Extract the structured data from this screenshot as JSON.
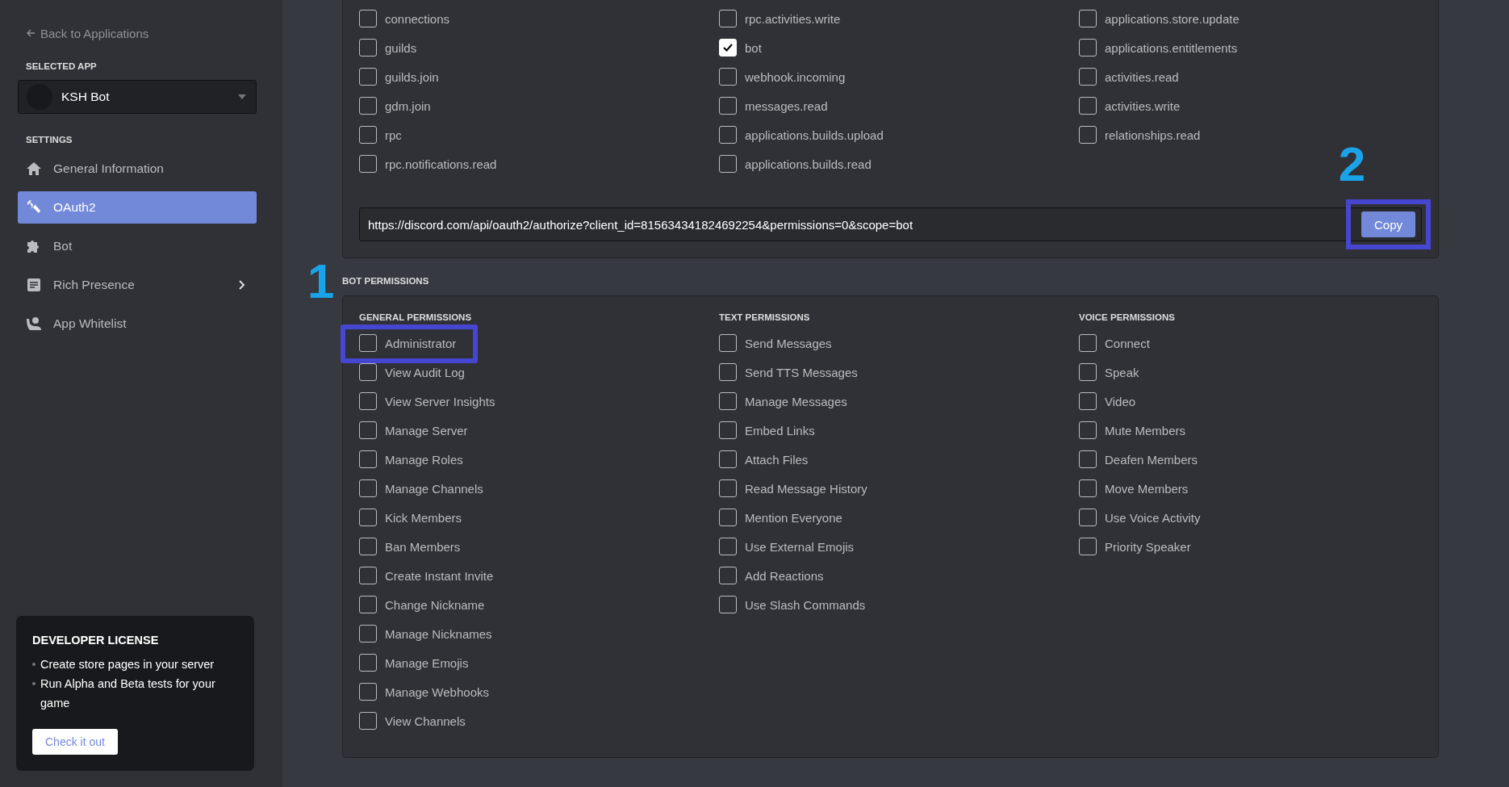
{
  "sidebar": {
    "back_link": "Back to Applications",
    "selected_app_label": "SELECTED APP",
    "selected_app": "KSH Bot",
    "settings_label": "SETTINGS",
    "items": [
      {
        "label": "General Information",
        "kind": "home",
        "selected": false,
        "expandable": false
      },
      {
        "label": "OAuth2",
        "kind": "wrench",
        "selected": true,
        "expandable": false
      },
      {
        "label": "Bot",
        "kind": "puzzle",
        "selected": false,
        "expandable": false
      },
      {
        "label": "Rich Presence",
        "kind": "document",
        "selected": false,
        "expandable": true
      },
      {
        "label": "App Whitelist",
        "kind": "person",
        "selected": false,
        "expandable": false
      }
    ]
  },
  "developer_license": {
    "title": "DEVELOPER LICENSE",
    "bullets": [
      "Create store pages in your server",
      "Run Alpha and Beta tests for your game"
    ],
    "button": "Check it out"
  },
  "scopes": {
    "columns": [
      [
        {
          "label": "connections",
          "checked": false
        },
        {
          "label": "guilds",
          "checked": false
        },
        {
          "label": "guilds.join",
          "checked": false
        },
        {
          "label": "gdm.join",
          "checked": false
        },
        {
          "label": "rpc",
          "checked": false
        },
        {
          "label": "rpc.notifications.read",
          "checked": false
        }
      ],
      [
        {
          "label": "rpc.activities.write",
          "checked": false
        },
        {
          "label": "bot",
          "checked": true
        },
        {
          "label": "webhook.incoming",
          "checked": false
        },
        {
          "label": "messages.read",
          "checked": false
        },
        {
          "label": "applications.builds.upload",
          "checked": false
        },
        {
          "label": "applications.builds.read",
          "checked": false
        }
      ],
      [
        {
          "label": "applications.store.update",
          "checked": false
        },
        {
          "label": "applications.entitlements",
          "checked": false
        },
        {
          "label": "activities.read",
          "checked": false
        },
        {
          "label": "activities.write",
          "checked": false
        },
        {
          "label": "relationships.read",
          "checked": false
        }
      ]
    ],
    "url": "https://discord.com/api/oauth2/authorize?client_id=815634341824692254&permissions=0&scope=bot",
    "copy_button": {
      "label": "Copy",
      "marker": "2"
    }
  },
  "bot_permissions": {
    "title": "BOT PERMISSIONS",
    "groups": [
      {
        "title": "GENERAL PERMISSIONS",
        "items": [
          {
            "label": "Administrator",
            "checked": false,
            "marker": "1"
          },
          {
            "label": "View Audit Log",
            "checked": false
          },
          {
            "label": "View Server Insights",
            "checked": false
          },
          {
            "label": "Manage Server",
            "checked": false
          },
          {
            "label": "Manage Roles",
            "checked": false
          },
          {
            "label": "Manage Channels",
            "checked": false
          },
          {
            "label": "Kick Members",
            "checked": false
          },
          {
            "label": "Ban Members",
            "checked": false
          },
          {
            "label": "Create Instant Invite",
            "checked": false
          },
          {
            "label": "Change Nickname",
            "checked": false
          },
          {
            "label": "Manage Nicknames",
            "checked": false
          },
          {
            "label": "Manage Emojis",
            "checked": false
          },
          {
            "label": "Manage Webhooks",
            "checked": false
          },
          {
            "label": "View Channels",
            "checked": false
          }
        ]
      },
      {
        "title": "TEXT PERMISSIONS",
        "items": [
          {
            "label": "Send Messages",
            "checked": false
          },
          {
            "label": "Send TTS Messages",
            "checked": false
          },
          {
            "label": "Manage Messages",
            "checked": false
          },
          {
            "label": "Embed Links",
            "checked": false
          },
          {
            "label": "Attach Files",
            "checked": false
          },
          {
            "label": "Read Message History",
            "checked": false
          },
          {
            "label": "Mention Everyone",
            "checked": false
          },
          {
            "label": "Use External Emojis",
            "checked": false
          },
          {
            "label": "Add Reactions",
            "checked": false
          },
          {
            "label": "Use Slash Commands",
            "checked": false
          }
        ]
      },
      {
        "title": "VOICE PERMISSIONS",
        "items": [
          {
            "label": "Connect",
            "checked": false
          },
          {
            "label": "Speak",
            "checked": false
          },
          {
            "label": "Video",
            "checked": false
          },
          {
            "label": "Mute Members",
            "checked": false
          },
          {
            "label": "Deafen Members",
            "checked": false
          },
          {
            "label": "Move Members",
            "checked": false
          },
          {
            "label": "Use Voice Activity",
            "checked": false
          },
          {
            "label": "Priority Speaker",
            "checked": false
          }
        ]
      }
    ]
  }
}
